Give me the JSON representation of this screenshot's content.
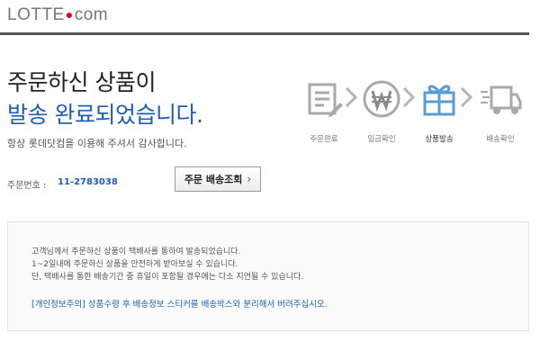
{
  "header": {
    "logo_part1": "LOTTE",
    "logo_dot": "●",
    "logo_part2": "com"
  },
  "main": {
    "title_line1": "주문하신 상품이",
    "title_line2": "발송 완료되었습니다.",
    "thanks": "항상 롯데닷컴을 이용해 주셔서 감사합니다.",
    "order_label": "주문번호 :",
    "order_number": "11-2783038",
    "track_button": "주문 배송조회",
    "track_button_chevron": "›"
  },
  "steps": [
    {
      "label": "주문완료",
      "icon": "order-document-icon"
    },
    {
      "label": "입금확인",
      "icon": "won-coin-icon"
    },
    {
      "label": "상품발송",
      "icon": "gift-box-icon"
    },
    {
      "label": "배송확인",
      "icon": "delivery-truck-icon"
    }
  ],
  "active_step": 3,
  "info": {
    "line1": "고객님께서 주문하신 상품이 택배사를 통하여 발송되었습니다.",
    "line2": "1~2일내에 주문하신 상품을 안전하게 받아보실 수 있습니다.",
    "line3": "단, 택배사를 통한 배송기간 중 휴일이 포함될 경우에는 다소 지연될 수 있습니다.",
    "notice": "[개인정보주의] 상품수령 후 배송정보 스티커를 배송박스와 분리해서 버려주십시오."
  },
  "colors": {
    "accent_blue": "#1e5fb4",
    "logo_red": "#e60012",
    "icon_gray": "#a9a9a9",
    "icon_active": "#5b9bd5"
  }
}
